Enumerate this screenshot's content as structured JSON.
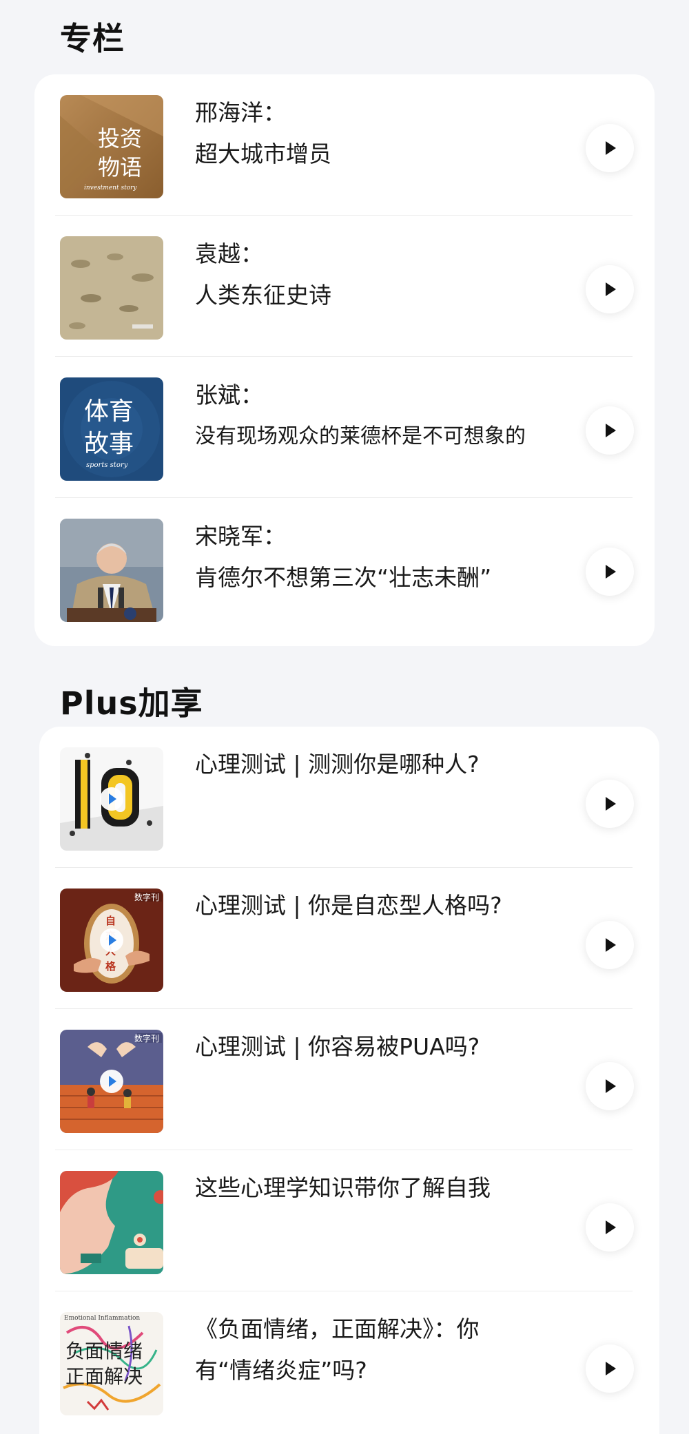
{
  "columns": {
    "title": "专栏",
    "items": [
      {
        "line1": "邢海洋：",
        "line2": "超大城市增员",
        "thumb_text_1": "投资",
        "thumb_text_2": "物语",
        "thumb_sub": "investment story"
      },
      {
        "line1": "袁越：",
        "line2": "人类东征史诗"
      },
      {
        "line1": "张斌：",
        "line2": "没有现场观众的莱德杯是不可想象的",
        "thumb_text_1": "体育",
        "thumb_text_2": "故事",
        "thumb_sub": "sports story"
      },
      {
        "line1": "宋晓军：",
        "line2": "肯德尔不想第三次“壮志未酬”"
      }
    ]
  },
  "plus": {
    "title": "Plus加享",
    "items": [
      {
        "text": "心理测试 | 测测你是哪种人?"
      },
      {
        "text": "心理测试 | 你是自恋型人格吗?",
        "thumb_badge": "数字刊",
        "thumb_chars": [
          "自",
          "恋",
          "人",
          "格"
        ]
      },
      {
        "text": "心理测试 | 你容易被PUA吗?",
        "thumb_badge": "数字刊"
      },
      {
        "text": "这些心理学知识带你了解自我"
      },
      {
        "text": "《负面情绪，正面解决》：你有“情绪炎症”吗?",
        "thumb_text_1": "负面情绪",
        "thumb_text_2": "正面解决",
        "thumb_top": "Emotional Inflammation"
      }
    ]
  },
  "colors": {
    "background": "#f4f5f8",
    "card": "#ffffff",
    "accent_play": "#2a7de1"
  }
}
